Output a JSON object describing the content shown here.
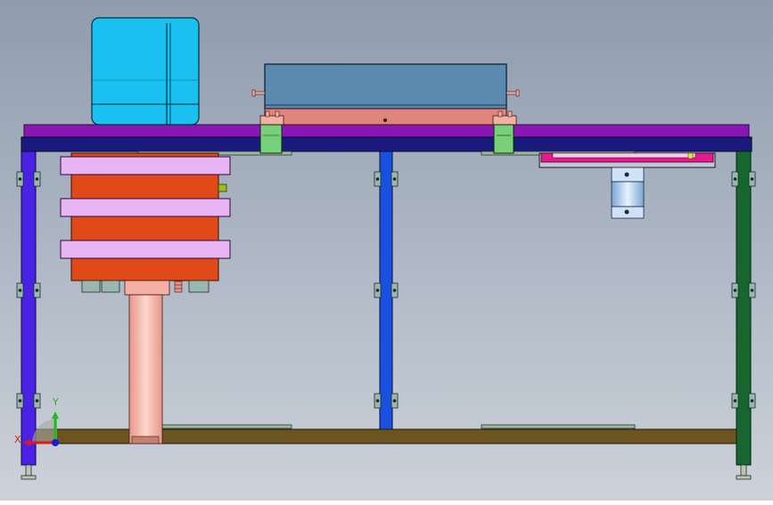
{
  "viewport": {
    "name": "cad-3d-viewport",
    "view": "front"
  },
  "colors": {
    "background_top": "#8f9cae",
    "background_bottom": "#ccd2da",
    "top_plate": "#8a16b4",
    "frame_beam": "#1a1a7e",
    "left_post": "#4a22e6",
    "middle_post": "#1a50e0",
    "right_post": "#176630",
    "bottom_rail": "#6b5420",
    "motor": "#19c0f0",
    "lift_block": "#e04a18",
    "lift_plate": "#e8b4f4",
    "cylinder_rod": "#f4b0a4",
    "box_body": "#5a8ab0",
    "box_base": "#e0847c",
    "clamp_block": "#78d078",
    "pink_slide": "#e81890",
    "cylinder_body": "#b4d4f4",
    "bracket": "#9ab8b0"
  },
  "triad": {
    "x_label": "X",
    "y_label": "Y",
    "x_color": "#e01818",
    "y_color": "#18c018",
    "z_color": "#1818e0"
  }
}
